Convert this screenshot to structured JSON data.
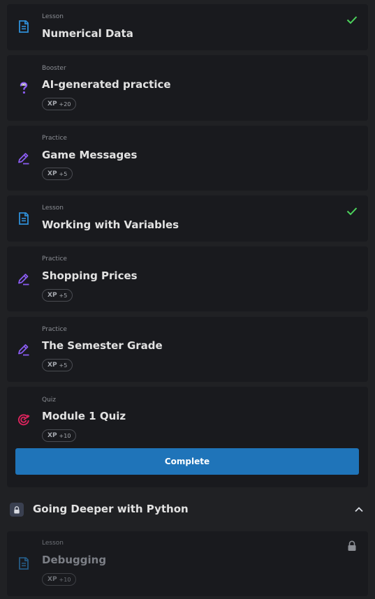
{
  "items": [
    {
      "kind": "Lesson",
      "title": "Numerical Data",
      "icon": "document-icon",
      "completed": true
    },
    {
      "kind": "Booster",
      "title": "AI-generated practice",
      "icon": "question-mark-icon",
      "xp_label": "XP",
      "xp_value": "+20"
    },
    {
      "kind": "Practice",
      "title": "Game Messages",
      "icon": "pencil-icon",
      "xp_label": "XP",
      "xp_value": "+5"
    },
    {
      "kind": "Lesson",
      "title": "Working with Variables",
      "icon": "document-icon",
      "completed": true
    },
    {
      "kind": "Practice",
      "title": "Shopping Prices",
      "icon": "pencil-icon",
      "xp_label": "XP",
      "xp_value": "+5"
    },
    {
      "kind": "Practice",
      "title": "The Semester Grade",
      "icon": "pencil-icon",
      "xp_label": "XP",
      "xp_value": "+5"
    },
    {
      "kind": "Quiz",
      "title": "Module 1 Quiz",
      "icon": "target-icon",
      "xp_label": "XP",
      "xp_value": "+10",
      "button_label": "Complete"
    }
  ],
  "section": {
    "title": "Going Deeper with Python",
    "locked": true,
    "expanded": true
  },
  "locked_item": {
    "kind": "Lesson",
    "title": "Debugging",
    "icon": "document-icon",
    "xp_label": "XP",
    "xp_value": "+10",
    "locked": true
  },
  "colors": {
    "check": "#4cd35c",
    "lesson_icon": "#2f8fd8",
    "practice_icon": "#8a5cf0",
    "quiz_icon": "#e0245e",
    "button": "#1f74b9"
  }
}
